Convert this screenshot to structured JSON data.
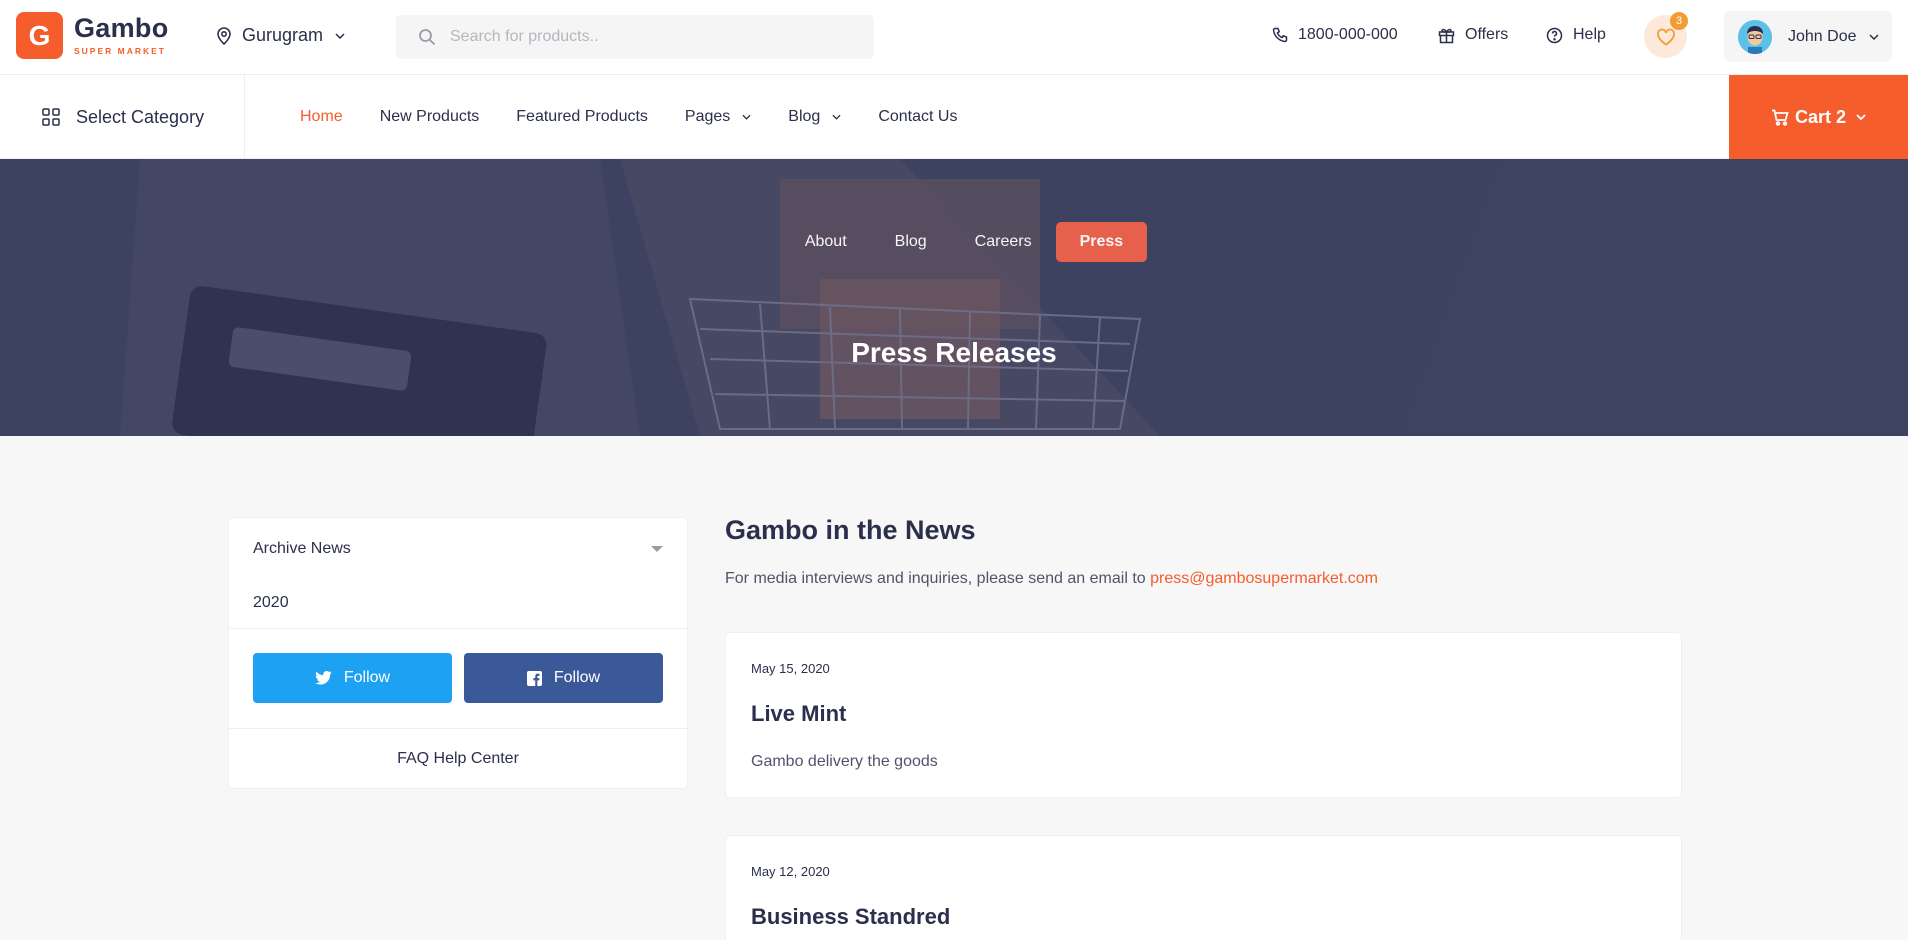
{
  "brand": {
    "mark": "G",
    "name": "Gambo",
    "tagline": "SUPER MARKET",
    "accent": "#f55d2c"
  },
  "header": {
    "location": "Gurugram",
    "search_placeholder": "Search for products..",
    "phone": "1800-000-000",
    "offers": "Offers",
    "help": "Help",
    "wishlist_count": "3",
    "user_name": "John Doe"
  },
  "nav": {
    "select_category": "Select Category",
    "items": [
      "Home",
      "New Products",
      "Featured Products",
      "Pages",
      "Blog",
      "Contact Us"
    ],
    "active": "Home",
    "cart_label": "Cart 2"
  },
  "hero": {
    "tabs": [
      "About",
      "Blog",
      "Careers",
      "Press"
    ],
    "active_tab": "Press",
    "title": "Press Releases"
  },
  "sidebar": {
    "archive_label": "Archive News",
    "year": "2020",
    "twitter_follow": "Follow",
    "facebook_follow": "Follow",
    "faq": "FAQ Help Center",
    "twitter_color": "#1da1f2",
    "facebook_color": "#3b5998"
  },
  "news": {
    "heading": "Gambo in the News",
    "intro": "For media interviews and inquiries, please send an email to ",
    "email": "press@gambosupermarket.com",
    "items": [
      {
        "date": "May 15, 2020",
        "source": "Live Mint",
        "headline": "Gambo delivery the goods"
      },
      {
        "date": "May 12, 2020",
        "source": "Business Standred",
        "headline": ""
      }
    ]
  }
}
